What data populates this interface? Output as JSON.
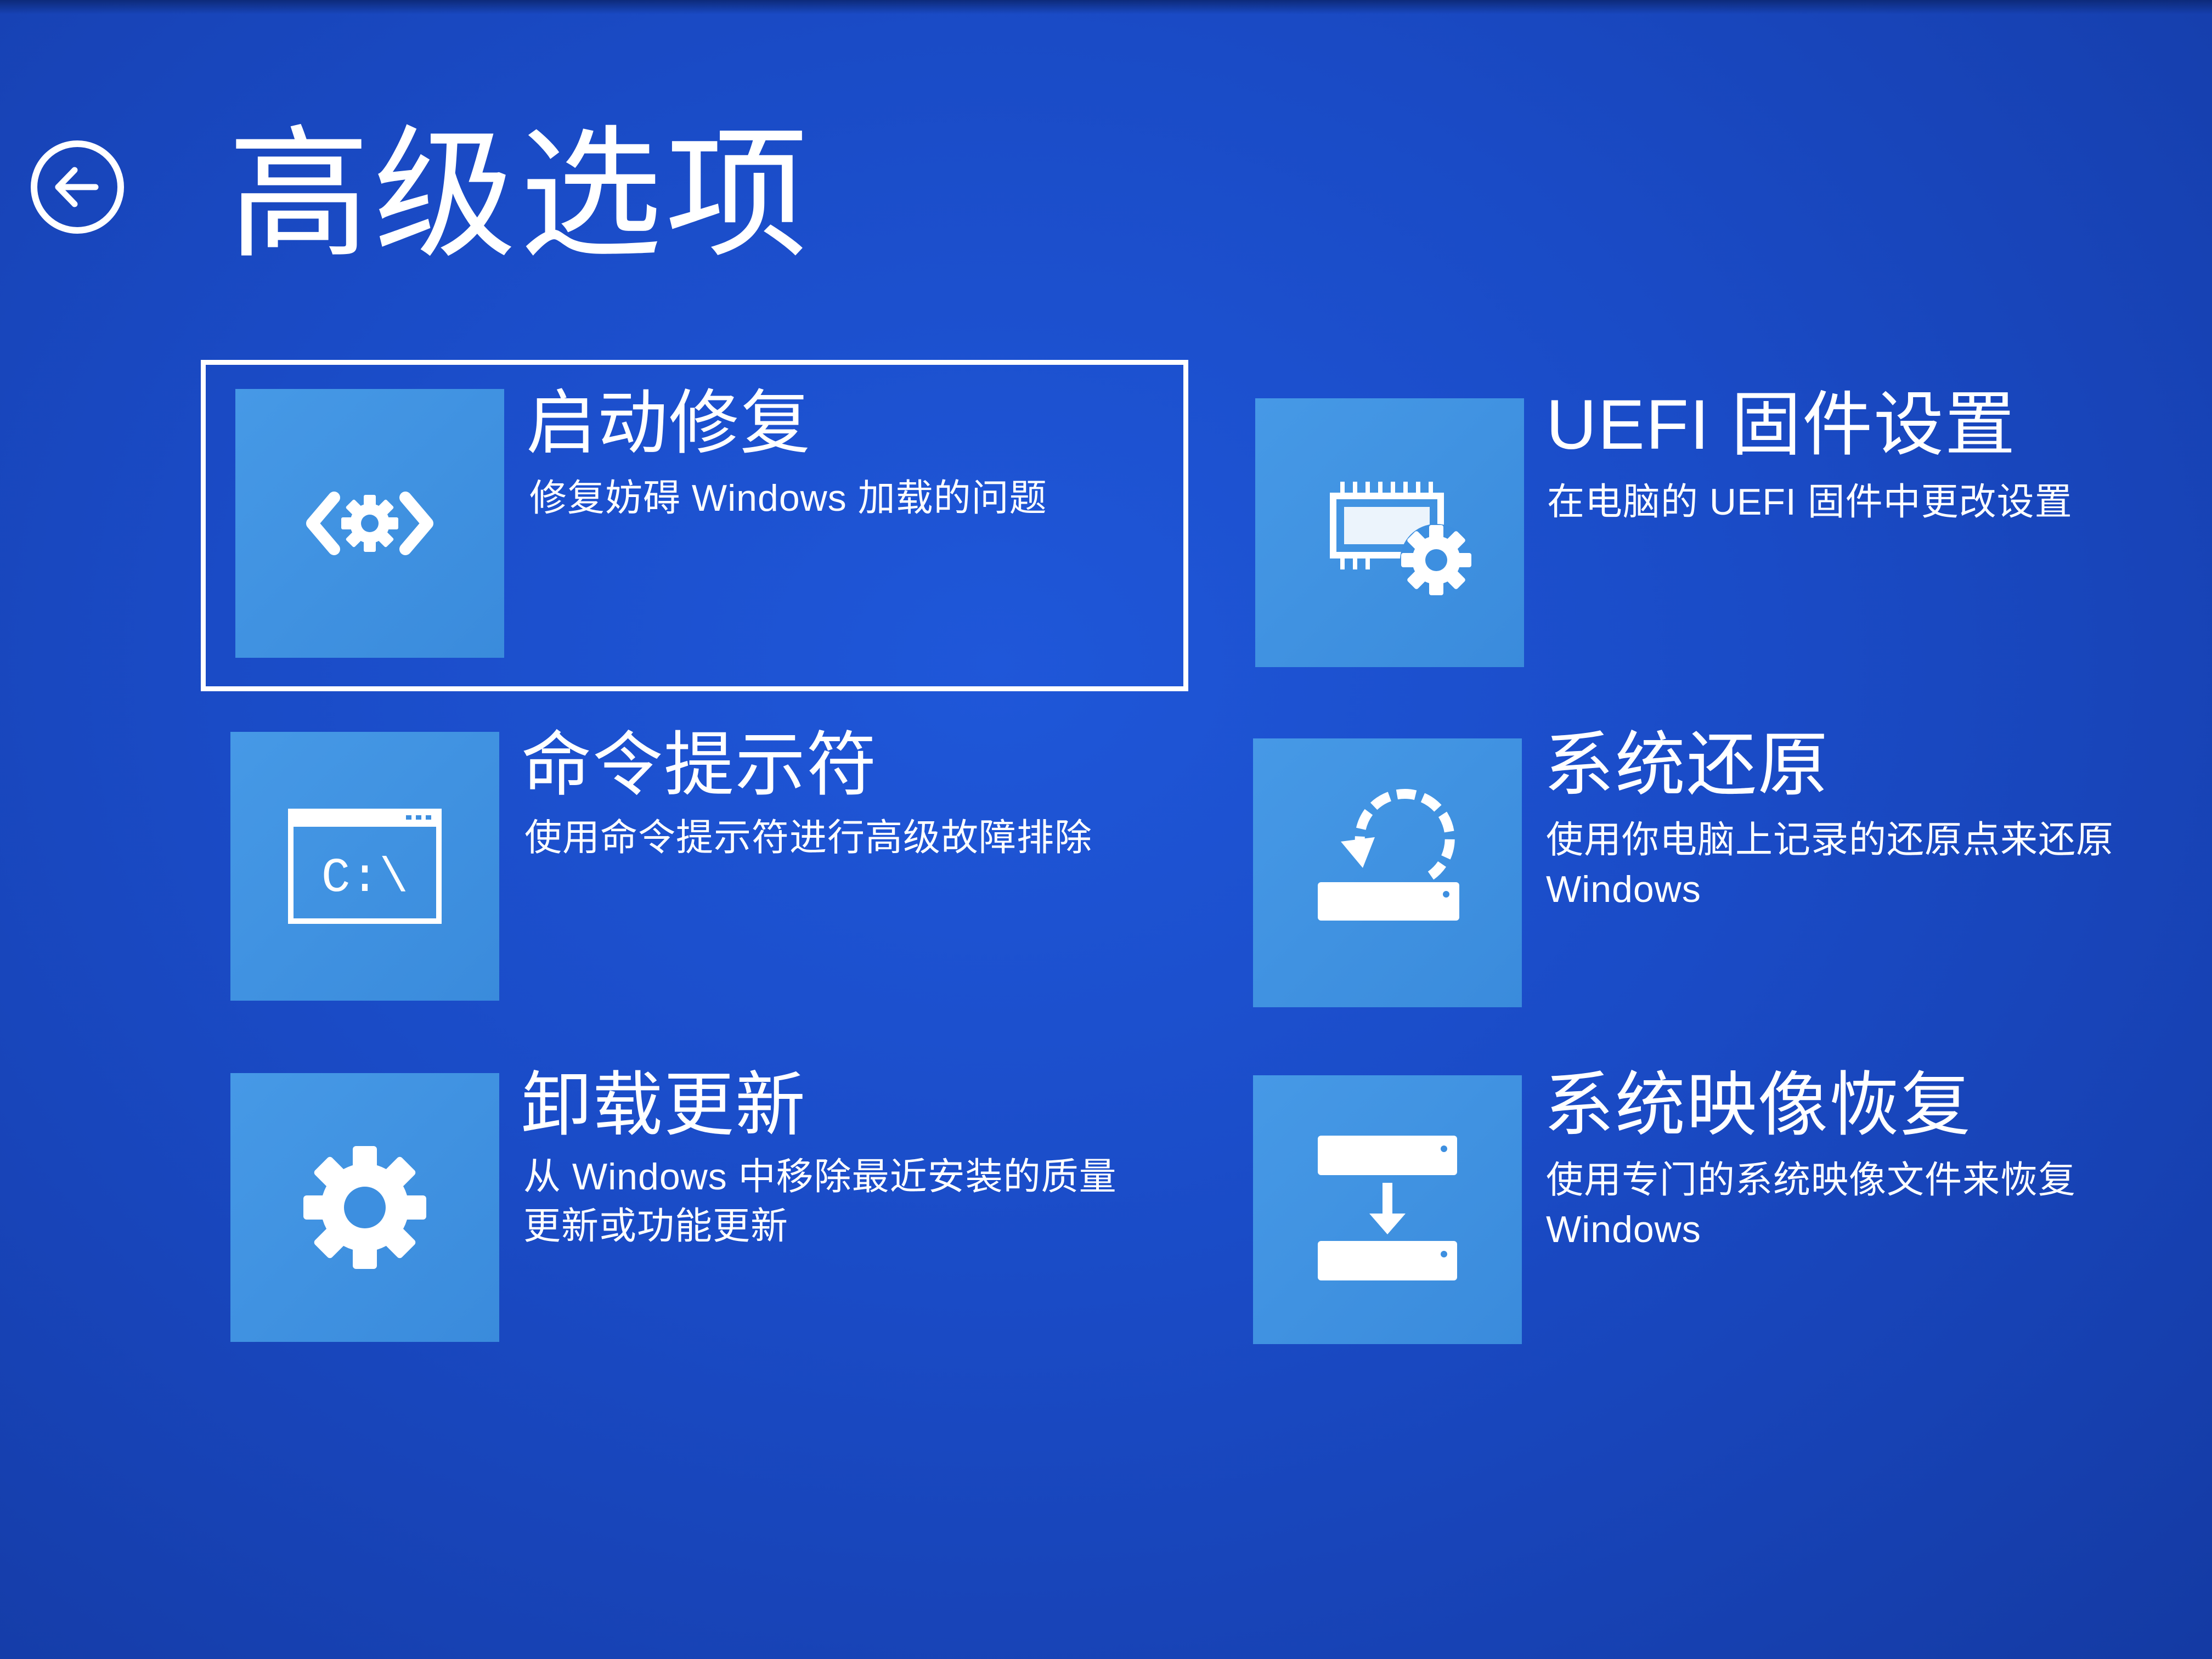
{
  "page": {
    "title": "高级选项",
    "back_icon": "back-arrow-icon"
  },
  "options": [
    {
      "id": "startup-repair",
      "title": "启动修复",
      "description": "修复妨碍 Windows 加载的问题",
      "icon": "startup-repair-icon",
      "selected": true
    },
    {
      "id": "uefi-settings",
      "title": "UEFI 固件设置",
      "description": "在电脑的 UEFI 固件中更改设置",
      "icon": "uefi-chip-gear-icon",
      "selected": false
    },
    {
      "id": "command-prompt",
      "title": "命令提示符",
      "description": "使用命令提示符进行高级故障排除",
      "icon": "command-prompt-icon",
      "icon_text": "C:\\",
      "selected": false
    },
    {
      "id": "system-restore",
      "title": "系统还原",
      "description": "使用你电脑上记录的还原点来还原 Windows",
      "icon": "system-restore-icon",
      "selected": false
    },
    {
      "id": "uninstall-updates",
      "title": "卸载更新",
      "description": "从 Windows 中移除最近安装的质量更新或功能更新",
      "icon": "gear-icon",
      "selected": false
    },
    {
      "id": "system-image-recovery",
      "title": "系统映像恢复",
      "description": "使用专门的系统映像文件来恢复 Windows",
      "icon": "system-image-recovery-icon",
      "selected": false
    }
  ],
  "colors": {
    "background": "#1a4bc6",
    "tile": "#3d8fe0",
    "text": "#ffffff"
  }
}
